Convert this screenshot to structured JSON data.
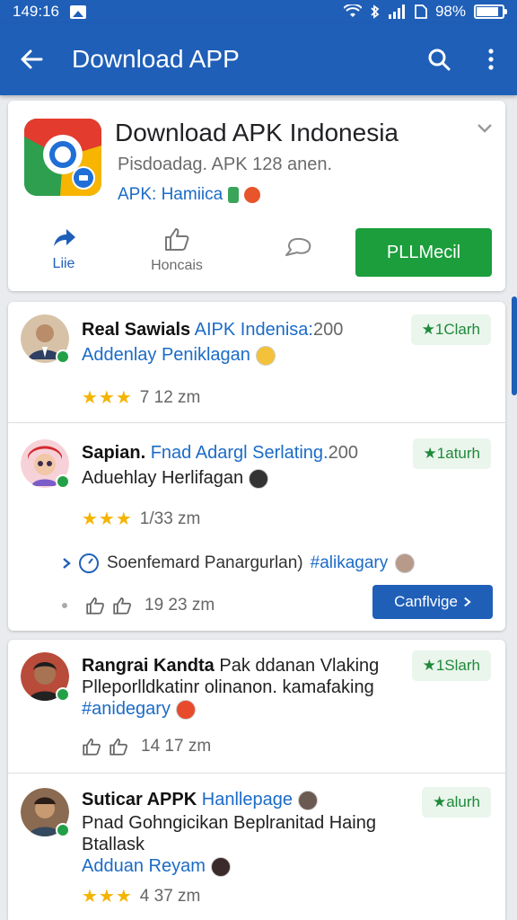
{
  "status": {
    "time": "149:16",
    "battery": "98%"
  },
  "appbar": {
    "title": "Download APP",
    "back_icon": "arrow-left-icon",
    "search_icon": "search-icon",
    "menu_icon": "more-vert-icon"
  },
  "app": {
    "title": "Download APK Indonesia",
    "subtitle": "Pisdoadag. APK 128 anen.",
    "tag": "APK: Hamiica",
    "actions": [
      {
        "label": "Liie",
        "icon": "share-icon"
      },
      {
        "label": "Honcais",
        "icon": "thumb-up-icon"
      },
      {
        "label": "",
        "icon": "chat-icon"
      }
    ],
    "primary": "PLLMecil"
  },
  "reviews": [
    {
      "name": "Real Sawials",
      "title_rest": "AIPK Indenisa:",
      "title_num": "200",
      "line2": "Addenlay Peniklagan",
      "badge": "★1Clarh",
      "meta": "7 12 zm",
      "stars": "★★★"
    },
    {
      "name": "Sapian.",
      "title_rest": "Fnad Adargl Serlating.",
      "title_num": "200",
      "line2": "Aduehlay Herlifagan",
      "badge": "★1aturh",
      "meta": "1/33 zm",
      "stars": "★★★",
      "sub_text": "Soenfemard Panargurlan)",
      "sub_tag": "#alikagary",
      "likes": "19 23 zm",
      "cta": "Canflvige"
    },
    {
      "name": "Rangrai Kandta",
      "title_rest": "Pak ddanan Vlaking",
      "line2": "Plleporlldkatinr olinanon. kamafaking",
      "line3": "#anidegary",
      "badge": "★1Slarh",
      "meta": "14 17 zm"
    },
    {
      "name": "Suticar APPK",
      "title_rest": "Hanllepage",
      "line2": "Pnad Gohngicikan Beplranitad Haing",
      "line3": "Btallask",
      "line4": "Adduan Reyam",
      "badge": "★alurh",
      "meta": "4 37 zm",
      "stars": "★★★"
    }
  ]
}
